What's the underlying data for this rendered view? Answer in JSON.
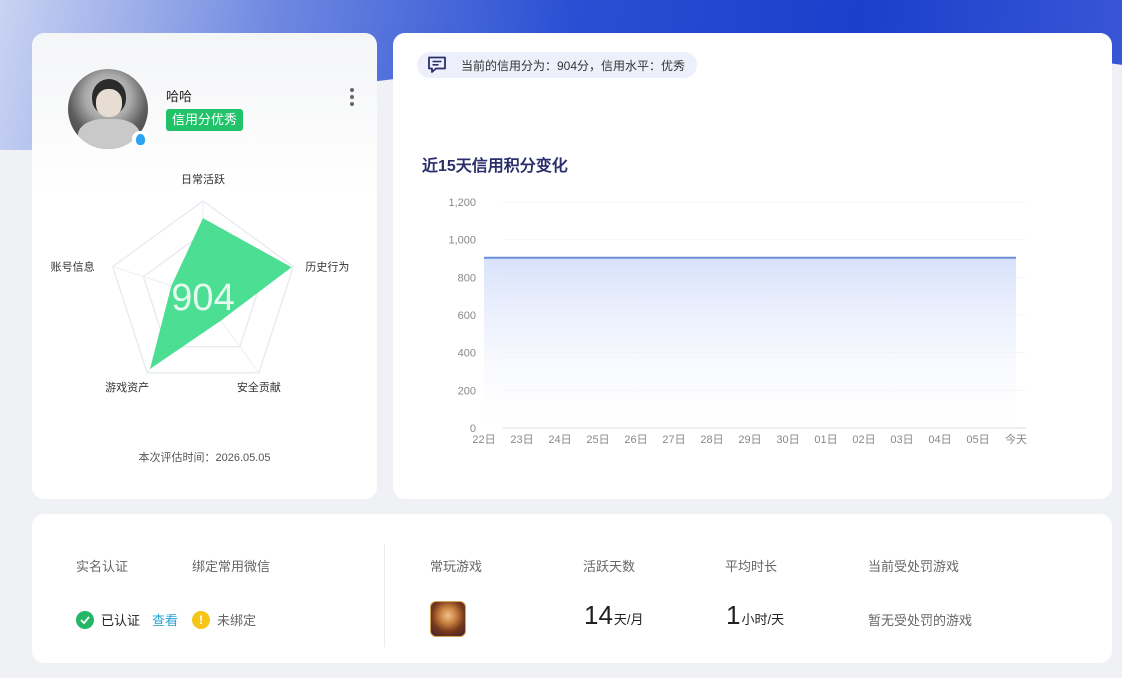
{
  "profile": {
    "username": "哈哈",
    "credit_tag": "信用分优秀",
    "score_text": "904",
    "eval_time": "本次评估时间：2026.05.05",
    "radar": {
      "axes": [
        "日常活跃",
        "历史行为",
        "安全贡献",
        "游戏资产",
        "账号信息"
      ],
      "values": [
        0.82,
        0.98,
        0.32,
        0.95,
        0.35
      ],
      "fill_color": "#3ddb8a"
    }
  },
  "credit_summary": {
    "text": "当前的信用分为：904分，信用水平：优秀"
  },
  "chart_data": {
    "type": "area",
    "title": "近15天信用积分变化",
    "x": [
      "22日",
      "23日",
      "24日",
      "25日",
      "26日",
      "27日",
      "28日",
      "29日",
      "30日",
      "01日",
      "02日",
      "03日",
      "04日",
      "05日",
      "今天"
    ],
    "series": [
      {
        "values": [
          904,
          904,
          904,
          904,
          904,
          904,
          904,
          904,
          904,
          904,
          904,
          904,
          904,
          904,
          904
        ]
      }
    ],
    "yticks": [
      "0",
      "200",
      "400",
      "600",
      "800",
      "1,000",
      "1,200"
    ],
    "ylim": [
      0,
      1200
    ],
    "grid": true,
    "line_color": "#6d8fd8"
  },
  "bottom": {
    "realname_label": "实名认证",
    "wechat_label": "绑定常用微信",
    "realname_status": "已认证",
    "view_link": "查看",
    "wechat_status": "未绑定",
    "games_label": "常玩游戏",
    "active_days_label": "活跃天数",
    "active_days_value": "14",
    "active_days_unit": "天/月",
    "avg_time_label": "平均时长",
    "avg_time_value": "1",
    "avg_time_unit": "小时/天",
    "punish_label": "当前受处罚游戏",
    "punish_value": "暂无受处罚的游戏"
  }
}
